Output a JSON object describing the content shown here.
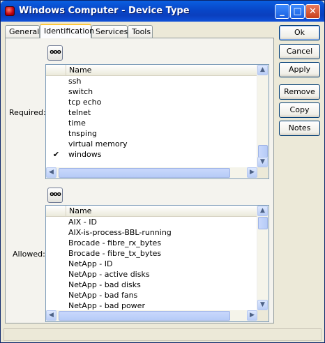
{
  "window": {
    "title": "Windows Computer - Device Type"
  },
  "tabs": [
    {
      "label": "General"
    },
    {
      "label": "Identification"
    },
    {
      "label": "Services"
    },
    {
      "label": "Tools"
    }
  ],
  "required": {
    "label": "Required:",
    "browse_label": "ooo",
    "column_header": "Name",
    "rows": [
      {
        "name": "ssh",
        "check": ""
      },
      {
        "name": "switch",
        "check": ""
      },
      {
        "name": "tcp echo",
        "check": ""
      },
      {
        "name": "telnet",
        "check": ""
      },
      {
        "name": "time",
        "check": ""
      },
      {
        "name": "tnsping",
        "check": ""
      },
      {
        "name": "virtual memory",
        "check": ""
      },
      {
        "name": "windows",
        "check": "✔"
      }
    ]
  },
  "allowed": {
    "label": "Allowed:",
    "browse_label": "ooo",
    "column_header": "Name",
    "rows": [
      {
        "name": "AIX - ID"
      },
      {
        "name": "AIX-is-process-BBL-running"
      },
      {
        "name": "Brocade - fibre_rx_bytes"
      },
      {
        "name": "Brocade - fibre_tx_bytes"
      },
      {
        "name": "NetApp - ID"
      },
      {
        "name": "NetApp - active disks"
      },
      {
        "name": "NetApp - bad disks"
      },
      {
        "name": "NetApp - bad fans"
      },
      {
        "name": "NetApp - bad power"
      }
    ]
  },
  "buttons": {
    "ok": "Ok",
    "cancel": "Cancel",
    "apply": "Apply",
    "remove": "Remove",
    "copy": "Copy",
    "notes": "Notes"
  }
}
